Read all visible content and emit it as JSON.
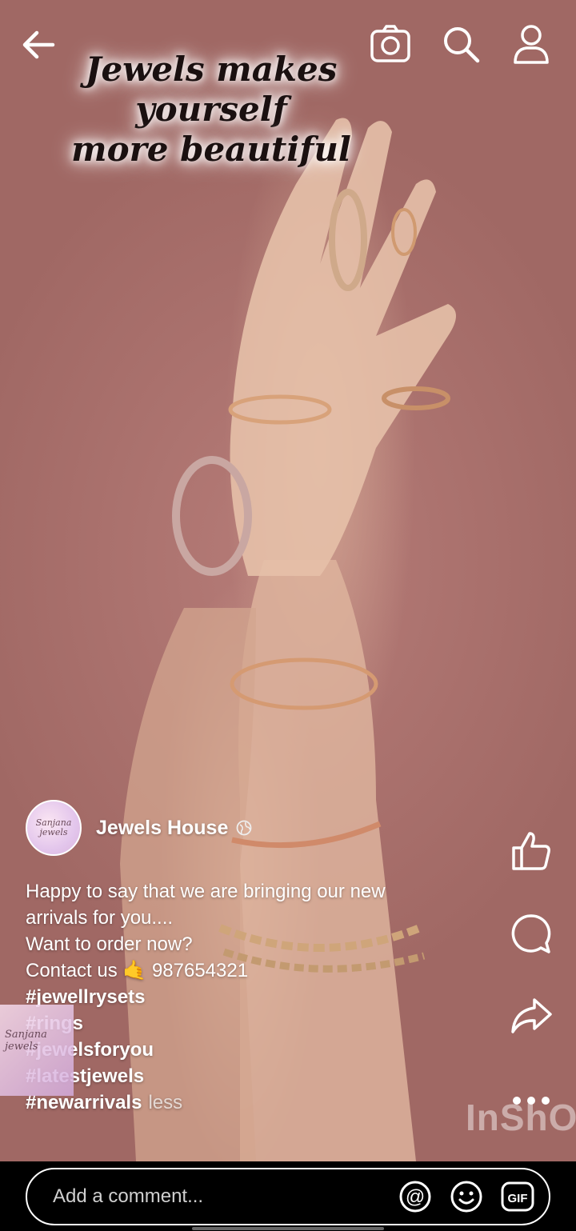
{
  "overlay": {
    "title_line1": "Jewels makes yourself",
    "title_line2": "more beautiful"
  },
  "topbar": {
    "icons": [
      "back-arrow-icon",
      "camera-icon",
      "search-icon",
      "profile-icon"
    ]
  },
  "post": {
    "author": "Jewels House",
    "avatar_text": "Sanjana jewels",
    "visibility_icon": "globe-icon",
    "caption_lines": [
      "Happy to say that we are bringing our new",
      "arrivals for you....",
      "Want to order now?",
      "Contact us  🤙 987654321"
    ],
    "hashtags": [
      "#jewellrysets",
      "#rings",
      "#jewelsforyou",
      "#latestjewels",
      "#newarrivals"
    ],
    "less_label": "less",
    "sticker_text": "Sanjana jewels"
  },
  "actions": {
    "icons": [
      "like-icon",
      "comment-icon",
      "share-icon",
      "more-icon"
    ]
  },
  "watermark": "InShO",
  "comment_bar": {
    "placeholder": "Add a comment...",
    "mention_symbol": "@",
    "gif_label": "GIF"
  },
  "colors": {
    "background": "#a06864",
    "text": "#ffffff",
    "bar": "#000000"
  }
}
